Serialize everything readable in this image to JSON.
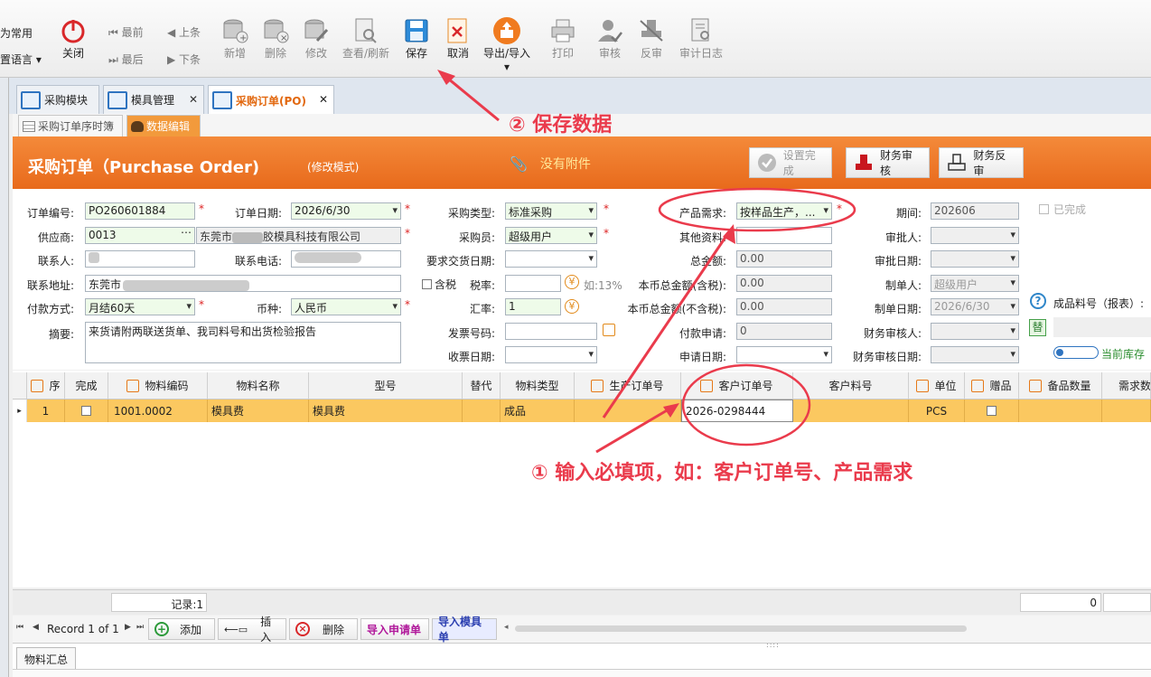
{
  "ribbon": {
    "left_items": [
      "为常用",
      "置语言"
    ],
    "close": "关闭",
    "nav": {
      "first": "最前",
      "prev": "上条",
      "last": "最后",
      "next": "下条"
    },
    "buttons": [
      "新增",
      "删除",
      "修改",
      "查看/刷新",
      "保存",
      "取消",
      "导出/导入",
      "打印",
      "审核",
      "反审",
      "审计日志"
    ]
  },
  "tabs": [
    "采购模块",
    "模具管理",
    "采购订单(PO)"
  ],
  "subtabs": [
    "采购订单序时簿",
    "数据编辑"
  ],
  "header": {
    "title": "采购订单（Purchase Order)",
    "mode": "(修改模式)",
    "attachment": "没有附件",
    "btn_complete": "设置完成",
    "btn_fin_audit": "财务审核",
    "btn_fin_unaudit": "财务反审"
  },
  "form": {
    "order_no_label": "订单编号:",
    "order_no": "PO260601884",
    "order_date_label": "订单日期:",
    "order_date": "2026/6/30",
    "purchase_type_label": "采购类型:",
    "purchase_type": "标准采购",
    "product_req_label": "产品需求:",
    "product_req": "按样品生产，...",
    "period_label": "期间:",
    "period": "202606",
    "completed_label": "已完成",
    "supplier_label": "供应商:",
    "supplier_code": "0013",
    "supplier_name_a": "东莞市",
    "supplier_name_b": "胶模具科技有限公司",
    "buyer_label": "采购员:",
    "buyer": "超级用户",
    "other_label": "其他资料:",
    "approver_label": "审批人:",
    "contact_label": "联系人:",
    "phone_label": "联系电话:",
    "delivery_label": "要求交货日期:",
    "total_label": "总金额:",
    "total": "0.00",
    "approve_date_label": "审批日期:",
    "address_label": "联系地址:",
    "address": "东莞市",
    "tax_incl_label": "含税",
    "tax_rate_label": "税率:",
    "tax_note": "如:13%",
    "local_total_tax_label": "本币总金额(含税):",
    "local_total_tax": "0.00",
    "maker_label": "制单人:",
    "maker": "超级用户",
    "pay_label": "付款方式:",
    "pay": "月结60天",
    "currency_label": "币种:",
    "currency": "人民币",
    "rate_label": "汇率:",
    "rate": "1",
    "local_total_notax_label": "本币总金额(不含税):",
    "local_total_notax": "0.00",
    "make_date_label": "制单日期:",
    "make_date": "2026/6/30",
    "product_no_label": "成品料号（报表）:",
    "summary_label": "摘要:",
    "summary": "来货请附两联送货单、我司料号和出货检验报告",
    "invoice_label": "发票号码:",
    "pay_req_label": "付款申请:",
    "pay_req": "0",
    "fin_auditor_label": "财务审核人:",
    "replace_label": "替",
    "receive_date_label": "收票日期:",
    "apply_date_label": "申请日期:",
    "fin_audit_date_label": "财务审核日期:",
    "stock_label": "当前库存"
  },
  "grid": {
    "headers": [
      "序",
      "完成",
      "物料编码",
      "物料名称",
      "型号",
      "替代",
      "物料类型",
      "生产订单号",
      "客户订单号",
      "客户料号",
      "单位",
      "赠品",
      "备品数量",
      "需求数"
    ],
    "rows": [
      {
        "seq": "1",
        "code": "1001.0002",
        "name": "模具费",
        "model": "模具费",
        "type": "成品",
        "cust_order": "2026-0298444",
        "unit": "PCS"
      }
    ],
    "record_count": "记录:1",
    "sum_value": "0"
  },
  "footer": {
    "record": "Record 1 of 1",
    "add": "添加",
    "insert": "插入",
    "delete": "删除",
    "import_req": "导入申请单",
    "import_mold": "导入模具单",
    "summary_tab": "物料汇总"
  },
  "annotations": {
    "step1": "① 输入必填项，如：客户订单号、产品需求",
    "step2": "② 保存数据"
  },
  "colors": {
    "header_orange": "#ee7a2a",
    "row_highlight": "#fbc860",
    "annotation_red": "#ea3b4c",
    "link_blue": "#2f74c0"
  }
}
